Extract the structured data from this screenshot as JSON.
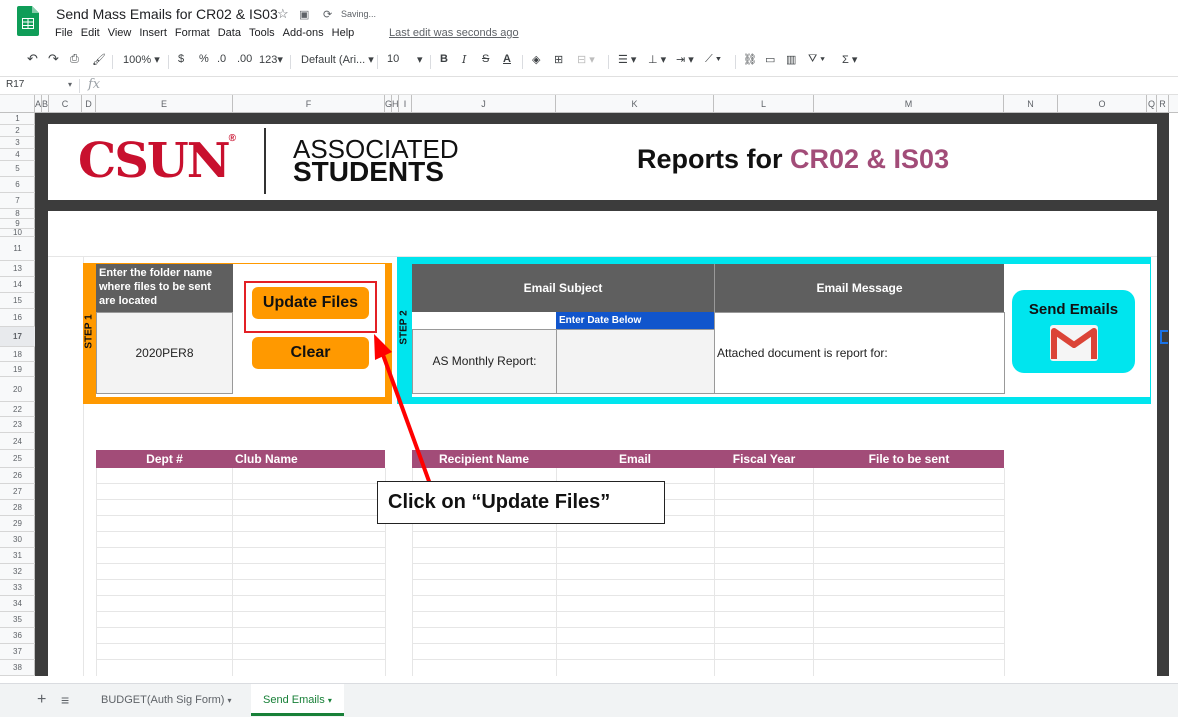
{
  "app": {
    "title": "Send Mass Emails for CR02 & IS03",
    "saving": "Saving...",
    "last_edit": "Last edit was seconds ago",
    "menu": [
      "File",
      "Edit",
      "View",
      "Insert",
      "Format",
      "Data",
      "Tools",
      "Add-ons",
      "Help"
    ]
  },
  "toolbar": {
    "zoom": "100%",
    "currency": "$",
    "percent": "%",
    "dec_less": ".0",
    "dec_more": ".00",
    "format": "123",
    "font": "Default (Ari...",
    "size": "10",
    "bold": "B",
    "italic": "I",
    "strike": "S",
    "color_a": "A"
  },
  "formula_bar": {
    "name_box": "R17",
    "fx": "fx"
  },
  "columns": [
    "A",
    "B",
    "C",
    "D",
    "E",
    "F",
    "G",
    "H",
    "I",
    "J",
    "K",
    "L",
    "M",
    "N",
    "O",
    "Q",
    "R"
  ],
  "rows": [
    "1",
    "2",
    "3",
    "4",
    "5",
    "6",
    "7",
    "8",
    "9",
    "10",
    "11",
    "13",
    "14",
    "15",
    "16",
    "17",
    "18",
    "19",
    "20",
    "22",
    "23",
    "24",
    "25",
    "26",
    "27",
    "28",
    "29",
    "30",
    "31",
    "32",
    "33",
    "34",
    "35",
    "36",
    "37",
    "38"
  ],
  "header": {
    "logo_text": "CSUN",
    "logo_reg": "®",
    "assoc": "ASSOCIATED",
    "students": "STUDENTS",
    "report_prefix": "Reports for ",
    "report_codes": "CR02 & IS03"
  },
  "step1": {
    "label": "STEP 1",
    "folder_prompt": "Enter the folder name where files to be sent are located",
    "folder_value": "2020PER8",
    "update_button": "Update Files",
    "clear_button": "Clear"
  },
  "step2": {
    "label": "STEP 2",
    "subject_header": "Email Subject",
    "message_header": "Email Message",
    "date_header": "Enter Date Below",
    "subject_value": "AS Monthly Report:",
    "message_value": "Attached document is report for:",
    "send_button": "Send Emails"
  },
  "table_left": [
    "Dept #",
    "Club Name"
  ],
  "table_right": [
    "Recipient Name",
    "Email",
    "Fiscal Year",
    "File to be sent"
  ],
  "callout": "Click on “Update Files”",
  "sheet_tabs": [
    {
      "label": "BUDGET(Auth Sig Form)",
      "active": false
    },
    {
      "label": "Send Emails",
      "active": true
    }
  ],
  "colors": {
    "accent_orange": "#ff9900",
    "accent_cyan": "#00e5ee",
    "table_header": "#a24c78",
    "csun_red": "#c8102e",
    "date_blue": "#1155cc"
  }
}
